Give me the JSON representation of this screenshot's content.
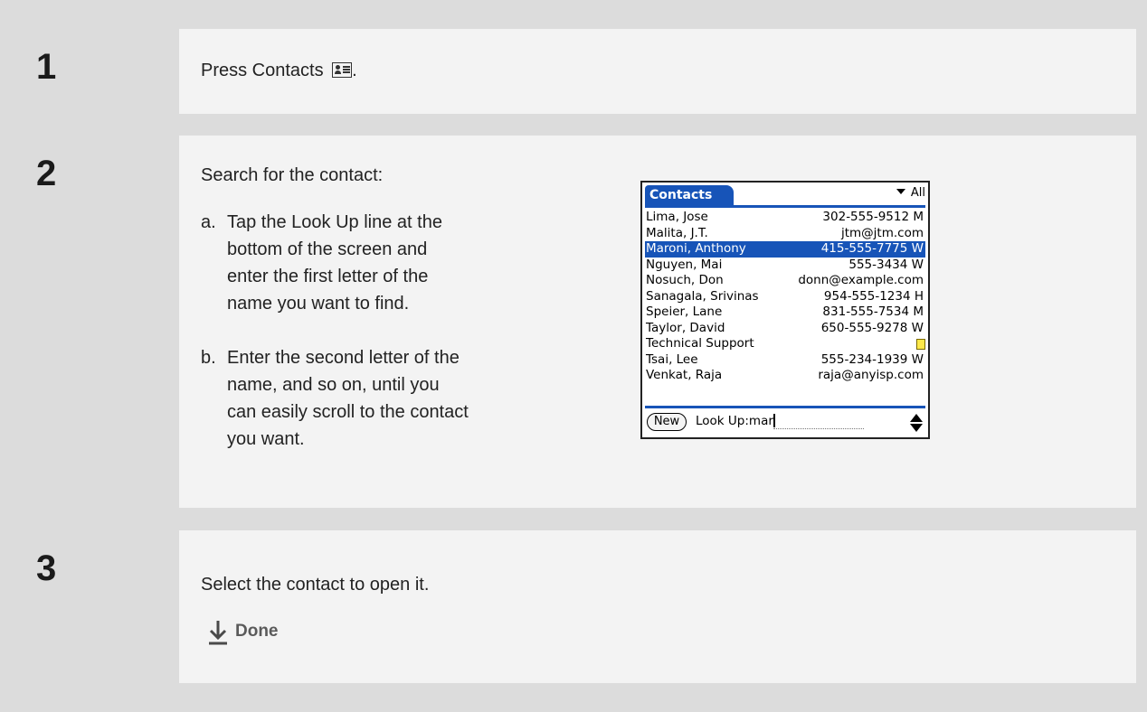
{
  "steps": [
    {
      "number": "1",
      "text_before_icon": "Press Contacts",
      "text_after_icon": ".",
      "icon": "contacts-icon"
    },
    {
      "number": "2",
      "intro": "Search for the contact:",
      "substeps": [
        {
          "label": "a.",
          "lines": [
            "Tap the Look Up line at the",
            "bottom of the screen and",
            "enter the first letter of the",
            "name you want to find."
          ]
        },
        {
          "label": "b.",
          "lines": [
            "Enter the second letter of the",
            "name, and so on, until you",
            "can easily scroll to the contact",
            "you want."
          ]
        }
      ]
    },
    {
      "number": "3",
      "text": "Select the contact to open it.",
      "done_label": "Done",
      "done_icon": "down-arrow-icon"
    }
  ],
  "palm_screen": {
    "tab_title": "Contacts",
    "category": "All",
    "contacts": [
      {
        "name": "Lima, Jose",
        "value": "302-555-9512 M",
        "selected": false
      },
      {
        "name": "Malita, J.T.",
        "value": "jtm@jtm.com",
        "selected": false
      },
      {
        "name": "Maroni, Anthony",
        "value": "415-555-7775 W",
        "selected": true
      },
      {
        "name": "Nguyen, Mai",
        "value": "555-3434 W",
        "selected": false
      },
      {
        "name": "Nosuch, Don",
        "value": "donn@example.com",
        "selected": false
      },
      {
        "name": "Sanagala, Srivinas",
        "value": "954-555-1234 H",
        "selected": false
      },
      {
        "name": "Speier, Lane",
        "value": "831-555-7534 M",
        "selected": false
      },
      {
        "name": "Taylor, David",
        "value": "650-555-9278 W",
        "selected": false
      },
      {
        "name": "Technical Support",
        "value": "",
        "selected": false,
        "note": true
      },
      {
        "name": "Tsai, Lee",
        "value": "555-234-1939 W",
        "selected": false
      },
      {
        "name": "Venkat, Raja",
        "value": "raja@anyisp.com",
        "selected": false
      }
    ],
    "new_button": "New",
    "lookup_label": "Look Up:",
    "lookup_value": "mar"
  },
  "colors": {
    "page_bg": "#dcdcdc",
    "panel_bg": "#f3f3f3",
    "palm_accent": "#1754b8"
  }
}
